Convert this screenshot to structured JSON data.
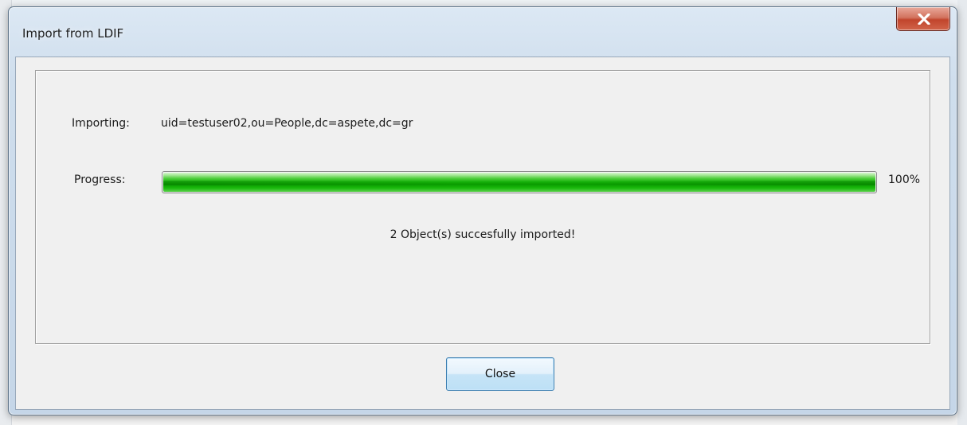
{
  "window": {
    "title": "Import from LDIF"
  },
  "import": {
    "importing_label": "Importing:",
    "importing_value": "uid=testuser02,ou=People,dc=aspete,dc=gr",
    "progress_label": "Progress:",
    "progress_value": 1.0,
    "progress_text": "100%",
    "status_message": "2 Object(s) succesfully imported!"
  },
  "buttons": {
    "close_label": "Close"
  },
  "icons": {
    "title_close": "close-x-icon"
  },
  "colors": {
    "progress_green": "#0a9d00",
    "button_border": "#3c7fb1",
    "title_close_red": "#c1452c"
  }
}
